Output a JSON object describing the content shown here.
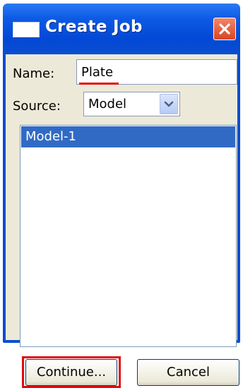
{
  "dialog": {
    "title": "Create Job",
    "name_label": "Name:",
    "name_value": "Plate",
    "source_label": "Source:",
    "source_value": "Model",
    "models": [
      "Model-1"
    ],
    "continue_label": "Continue...",
    "cancel_label": "Cancel"
  },
  "icons": {
    "title": "window-icon",
    "close": "close-x-icon",
    "dropdown": "chevron-down-icon"
  },
  "colors": {
    "titlebar": "#0a4ecf",
    "close_button": "#d9441f",
    "selection": "#316ac5",
    "highlight": "#e10c0c",
    "dialog_bg": "#ece9d8"
  }
}
